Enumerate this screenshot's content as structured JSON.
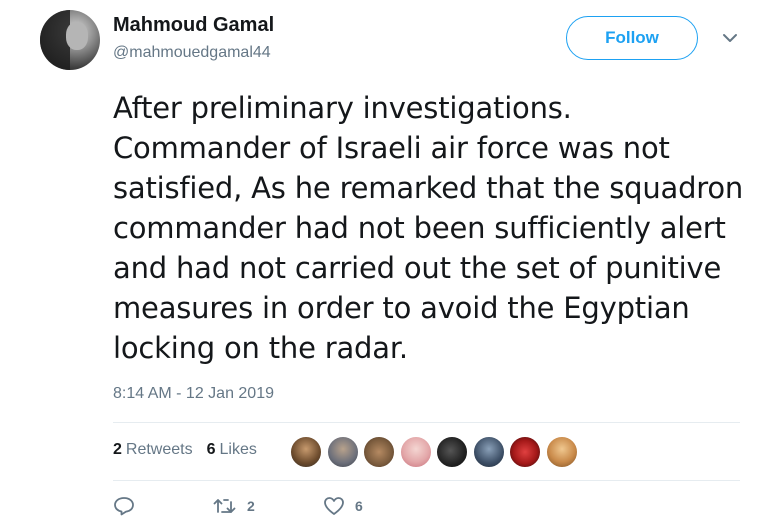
{
  "user": {
    "name": "Mahmoud Gamal",
    "handle": "@mahmouedgamal44"
  },
  "follow_label": "Follow",
  "tweet": {
    "text": "After preliminary investigations. Commander of Israeli air force was not satisfied, As he remarked that the squadron commander had not been sufficiently alert and had not carried out the set of punitive measures in order to avoid the Egyptian locking on the radar.",
    "timestamp": "8:14 AM - 12 Jan 2019"
  },
  "stats": {
    "retweets_count": "2",
    "retweets_label": "Retweets",
    "likes_count": "6",
    "likes_label": "Likes"
  },
  "actions": {
    "reply_icon": "reply-icon",
    "retweet_count": "2",
    "like_count": "6"
  },
  "colors": {
    "accent": "#1da1f2",
    "secondary_text": "#657786",
    "divider": "#e6ecf0"
  }
}
